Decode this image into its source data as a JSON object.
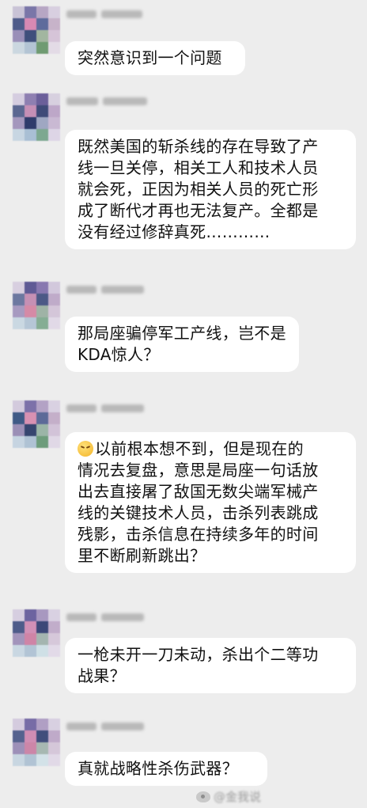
{
  "messages": [
    {
      "text_lines": [
        "突然意识到一个问题"
      ]
    },
    {
      "text_lines": [
        "既然美国的斩杀线的存在导致了产",
        "线一旦关停，相关工人和技术人员",
        "就会死，正因为相关人员的死亡形",
        "成了断代才再也无法复产。全都是",
        "没有经过修辞真死…………"
      ]
    },
    {
      "text_lines": [
        "那局座骗停军工产线，岂不是",
        "KDA惊人？"
      ]
    },
    {
      "text_lines": [
        "以前根本想不到，但是现在的",
        "情况去复盘，意思是局座一句话放",
        "出去直接屠了敌国无数尖端军械产",
        "线的关键技术人员，击杀列表跳成",
        "残影，击杀信息在持续多年的时间",
        "里不断刷新跳出？"
      ]
    },
    {
      "text_lines": [
        "一枪未开一刀未动，杀出个二等功",
        "战果？"
      ]
    },
    {
      "text_lines": [
        "真就战略性杀伤武器？"
      ]
    }
  ],
  "watermark": {
    "icon": "weibo-icon",
    "handle": "@金我说"
  }
}
